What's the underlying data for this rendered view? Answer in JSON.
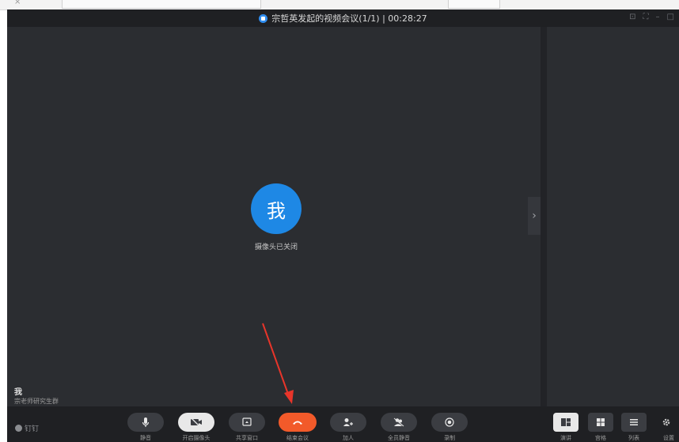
{
  "meeting": {
    "title": "宗哲英发起的视频会议(1/1) | 00:28:27",
    "avatar_text": "我",
    "camera_status": "摄像头已关闭",
    "self_name": "我",
    "self_org": "宗老师研究生群"
  },
  "toolbar": {
    "brand": "钉钉",
    "buttons": [
      {
        "label": "静音",
        "icon": "microphone-icon"
      },
      {
        "label": "开启摄像头",
        "icon": "camera-off-icon"
      },
      {
        "label": "共享窗口",
        "icon": "share-window-icon"
      },
      {
        "label": "结束会议",
        "icon": "hangup-icon"
      },
      {
        "label": "加人",
        "icon": "add-person-icon"
      },
      {
        "label": "全员静音",
        "icon": "mute-all-icon"
      },
      {
        "label": "录制",
        "icon": "record-icon"
      }
    ],
    "views": [
      {
        "label": "演讲",
        "icon": "speaker-view-icon"
      },
      {
        "label": "宫格",
        "icon": "grid-view-icon"
      },
      {
        "label": "列表",
        "icon": "list-view-icon"
      }
    ],
    "settings": "设置"
  },
  "colors": {
    "accent_blue": "#1e88e5",
    "end_call_red": "#f25a2a",
    "annotation_red": "#e8352a"
  }
}
